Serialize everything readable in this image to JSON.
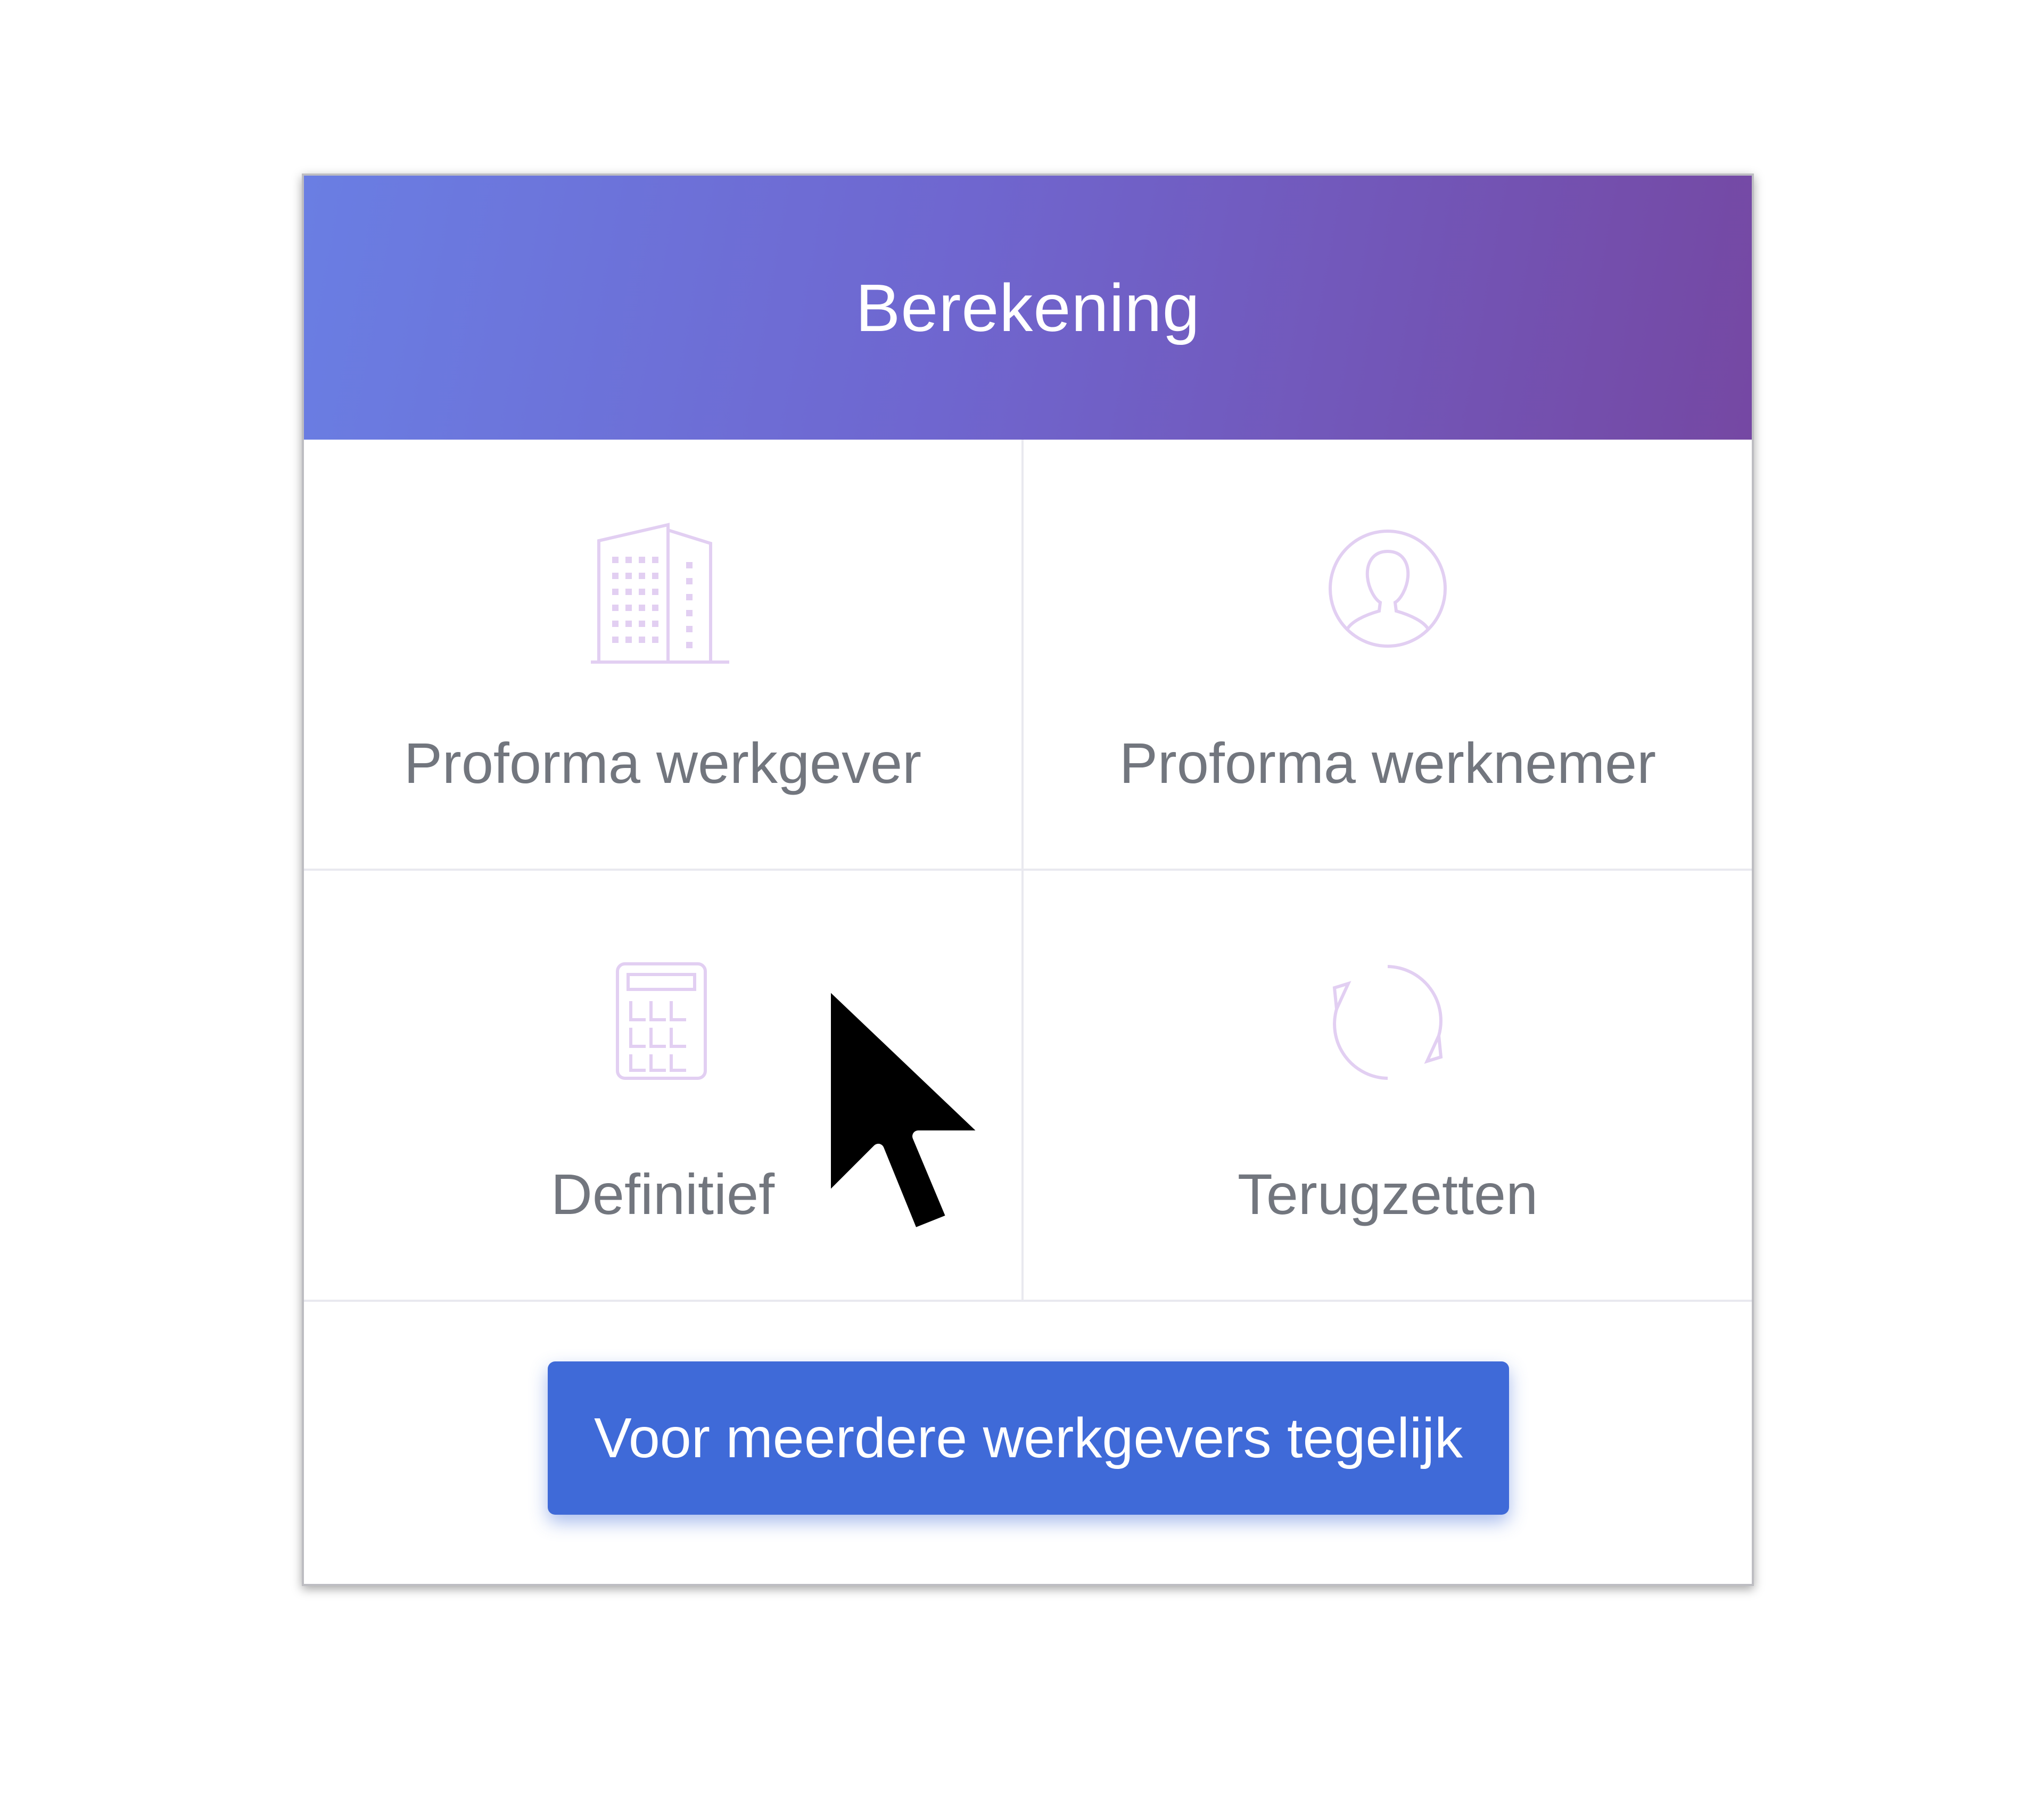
{
  "card": {
    "title": "Berekening"
  },
  "tiles": [
    {
      "label": "Proforma werkgever",
      "icon": "building-icon"
    },
    {
      "label": "Proforma werknemer",
      "icon": "user-circle-icon"
    },
    {
      "label": "Definitief",
      "icon": "calculator-icon"
    },
    {
      "label": "Terugzetten",
      "icon": "refresh-icon"
    }
  ],
  "footer": {
    "button_label": "Voor meerdere werkgevers tegelijk"
  },
  "colors": {
    "header_gradient_start": "#6a7ee3",
    "header_gradient_end": "#7548a3",
    "button": "#3f6ad8",
    "icon_tint": "#e2cff2",
    "label_text": "#72767e"
  }
}
